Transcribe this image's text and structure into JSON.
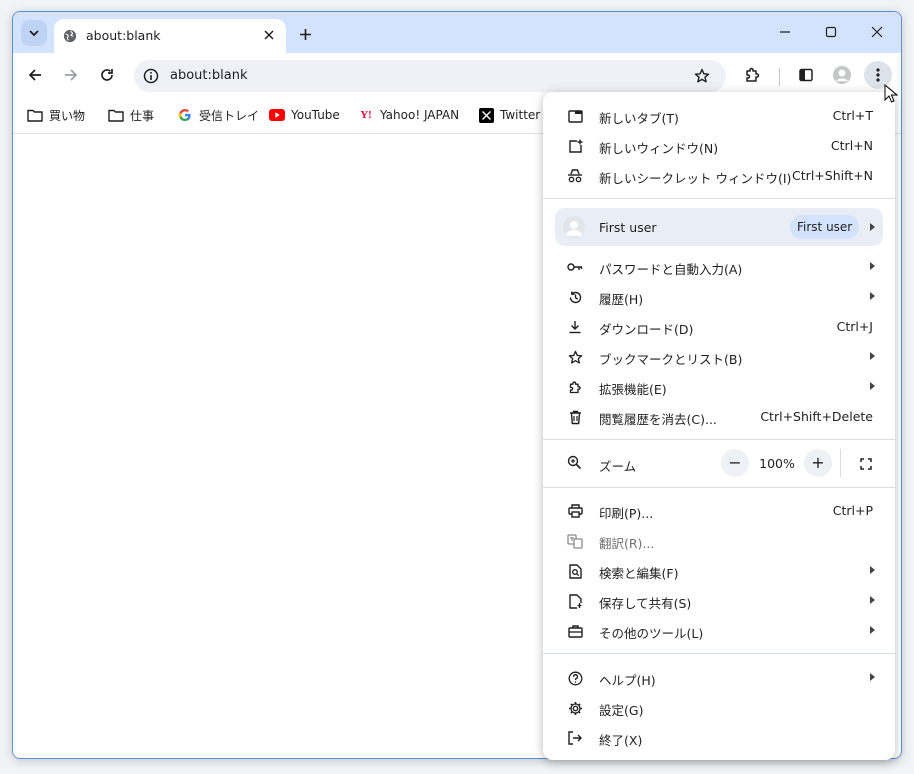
{
  "window": {
    "tab": {
      "title": "about:blank"
    },
    "controls": {
      "minimize": "minimize",
      "maximize": "maximize",
      "close": "close"
    }
  },
  "toolbar": {
    "url": "about:blank"
  },
  "bookmarks": [
    {
      "label": "買い物",
      "icon": "folder-icon"
    },
    {
      "label": "仕事",
      "icon": "folder-icon"
    },
    {
      "label": "受信トレイ",
      "icon": "google-icon"
    },
    {
      "label": "YouTube",
      "icon": "youtube-icon"
    },
    {
      "label": "Yahoo! JAPAN",
      "icon": "yahoo-icon"
    },
    {
      "label": "Twitter",
      "icon": "x-icon"
    }
  ],
  "menu": {
    "new_tab": {
      "label": "新しいタブ(T)",
      "shortcut": "Ctrl+T"
    },
    "new_window": {
      "label": "新しいウィンドウ(N)",
      "shortcut": "Ctrl+N"
    },
    "incognito": {
      "label": "新しいシークレット ウィンドウ(I)",
      "shortcut": "Ctrl+Shift+N"
    },
    "profile": {
      "name": "First user",
      "badge": "First user"
    },
    "passwords": {
      "label": "パスワードと自動入力(A)"
    },
    "history": {
      "label": "履歴(H)"
    },
    "downloads": {
      "label": "ダウンロード(D)",
      "shortcut": "Ctrl+J"
    },
    "bookmarks": {
      "label": "ブックマークとリスト(B)"
    },
    "extensions": {
      "label": "拡張機能(E)"
    },
    "clear_data": {
      "label": "閲覧履歴を消去(C)...",
      "shortcut": "Ctrl+Shift+Delete"
    },
    "zoom": {
      "label": "ズーム",
      "value": "100%",
      "minus": "−",
      "plus": "+"
    },
    "print": {
      "label": "印刷(P)...",
      "shortcut": "Ctrl+P"
    },
    "translate": {
      "label": "翻訳(R)..."
    },
    "find_edit": {
      "label": "検索と編集(F)"
    },
    "save_share": {
      "label": "保存して共有(S)"
    },
    "more_tools": {
      "label": "その他のツール(L)"
    },
    "help": {
      "label": "ヘルプ(H)"
    },
    "settings": {
      "label": "設定(G)"
    },
    "exit": {
      "label": "終了(X)"
    }
  },
  "colors": {
    "titlebar": "#d3e3fd",
    "accent": "#0b57d0",
    "youtube": "#ff0000",
    "yahoo": "#ff0033"
  }
}
